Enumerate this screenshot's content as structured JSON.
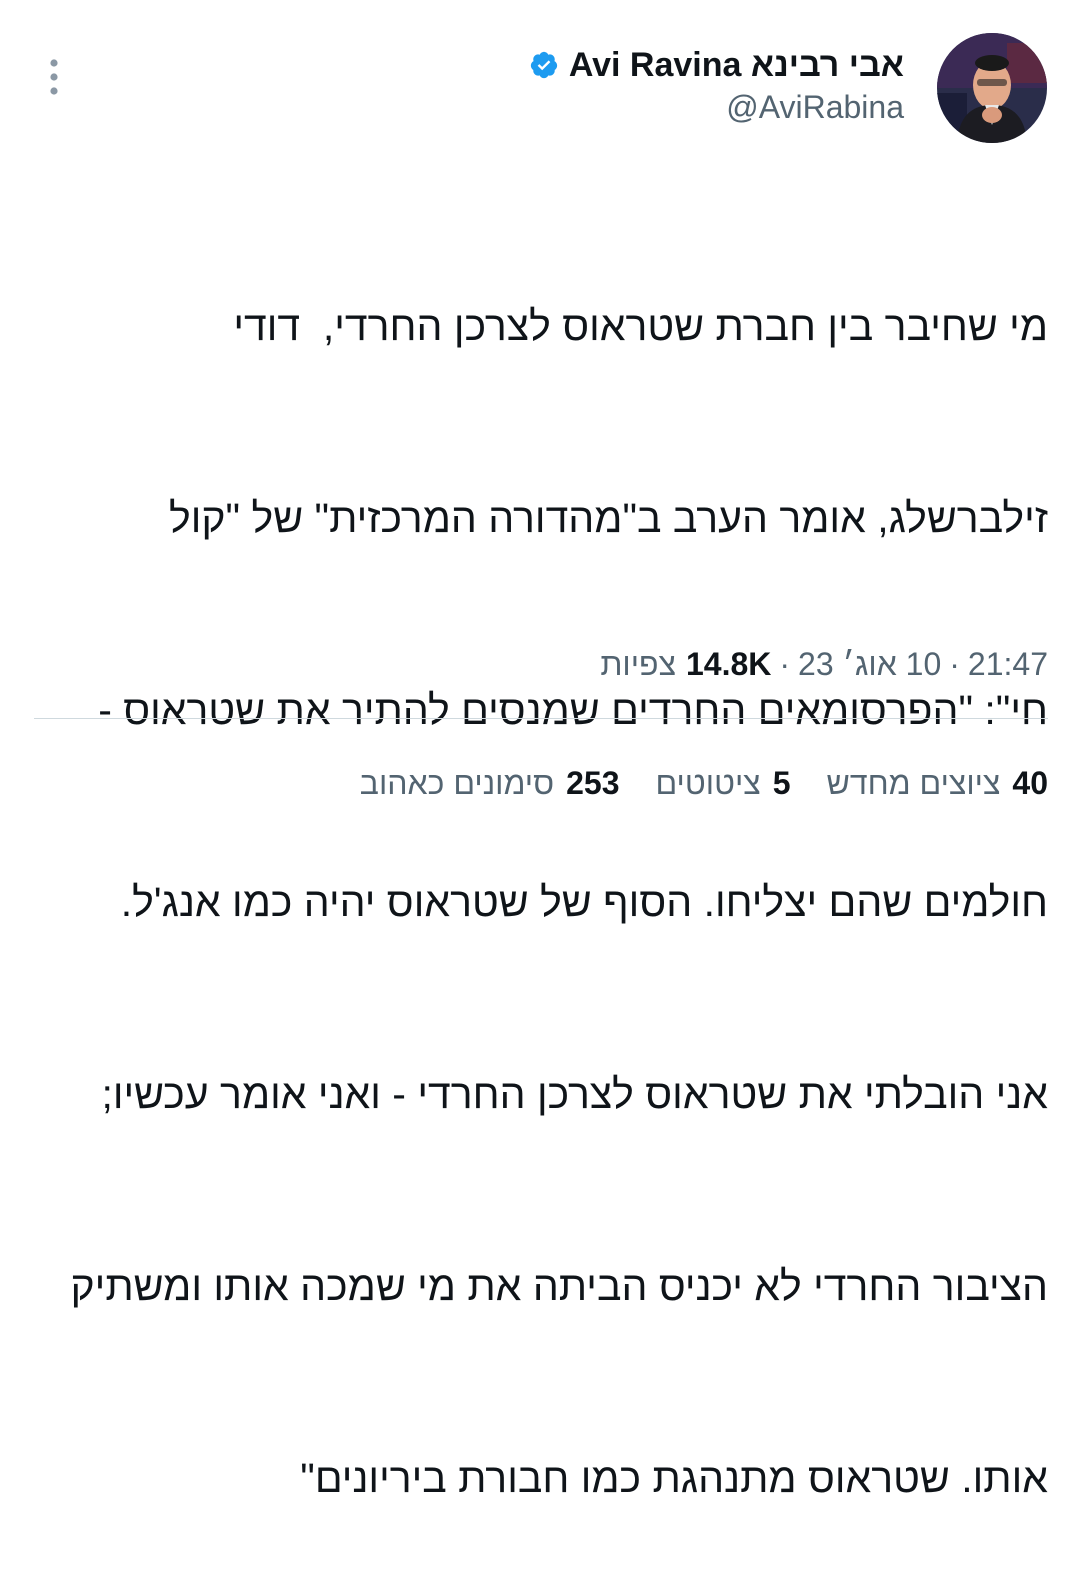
{
  "author": {
    "display_name": "Avi Ravina אבי רבינא",
    "handle": "@AviRabina",
    "verified": true,
    "verified_color": "#1d9bf0"
  },
  "tweet": {
    "lines": [
      "מי שחיבר בין חברת שטראוס לצרכן החרדי,  דודי",
      "זילברשלג, אומר הערב ב\"מהדורה המרכזית\" של \"קול",
      "חי\": \"הפרסומאים החרדים שמנסים להתיר את שטראוס -",
      "חולמים שהם יצליחו. הסוף של שטראוס יהיה כמו אנג'ל.",
      "אני הובלתי את שטראוס לצרכן החרדי - ואני אומר עכשיו;",
      "הציבור החרדי לא יכניס הביתה את מי שמכה אותו ומשתיק",
      "אותו. שטראוס מתנהגת כמו חבורת ביריונים\""
    ]
  },
  "meta": {
    "time": "21:47",
    "separator": "·",
    "date": "10 אוג׳ 23",
    "views_count": "14.8K",
    "views_label": "צפיות"
  },
  "stats": {
    "retweets": {
      "count": "40",
      "label": "ציוצים מחדש"
    },
    "quotes": {
      "count": "5",
      "label": "ציטוטים"
    },
    "likes": {
      "count": "253",
      "label": "סימונים כאהוב"
    }
  },
  "icons": {
    "more": "more-vertical-icon",
    "verified": "verified-badge-icon",
    "avatar": "avatar"
  }
}
